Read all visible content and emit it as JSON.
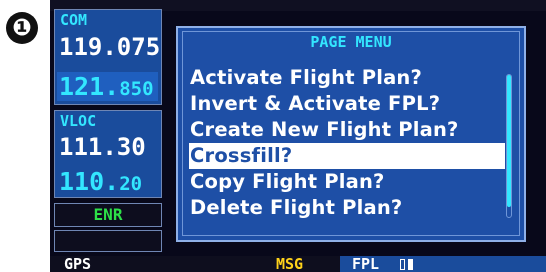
{
  "step_marker": "❶",
  "com": {
    "label": "COM",
    "active": "119.075",
    "standby_main": "121.",
    "standby_small": "850"
  },
  "vloc": {
    "label": "VLOC",
    "active": "111.30",
    "standby_main": "110.",
    "standby_small": "20"
  },
  "mode_annunciation": "ENR",
  "page_menu": {
    "title": "PAGE MENU",
    "items": [
      {
        "label": "Activate Flight Plan?",
        "selected": false
      },
      {
        "label": "Invert & Activate FPL?",
        "selected": false
      },
      {
        "label": "Create New Flight Plan?",
        "selected": false
      },
      {
        "label": "Crossfill?",
        "selected": true
      },
      {
        "label": "Copy Flight Plan?",
        "selected": false
      },
      {
        "label": "Delete Flight Plan?",
        "selected": false
      }
    ]
  },
  "status_bar": {
    "gps": "GPS",
    "msg": "MSG",
    "fpl": "FPL"
  },
  "colors": {
    "panel_blue": "#1a4c9c",
    "menu_blue": "#1e4fa6",
    "cyan": "#33e6ff",
    "enr_green": "#2de048",
    "msg_yellow": "#ffd21a"
  }
}
